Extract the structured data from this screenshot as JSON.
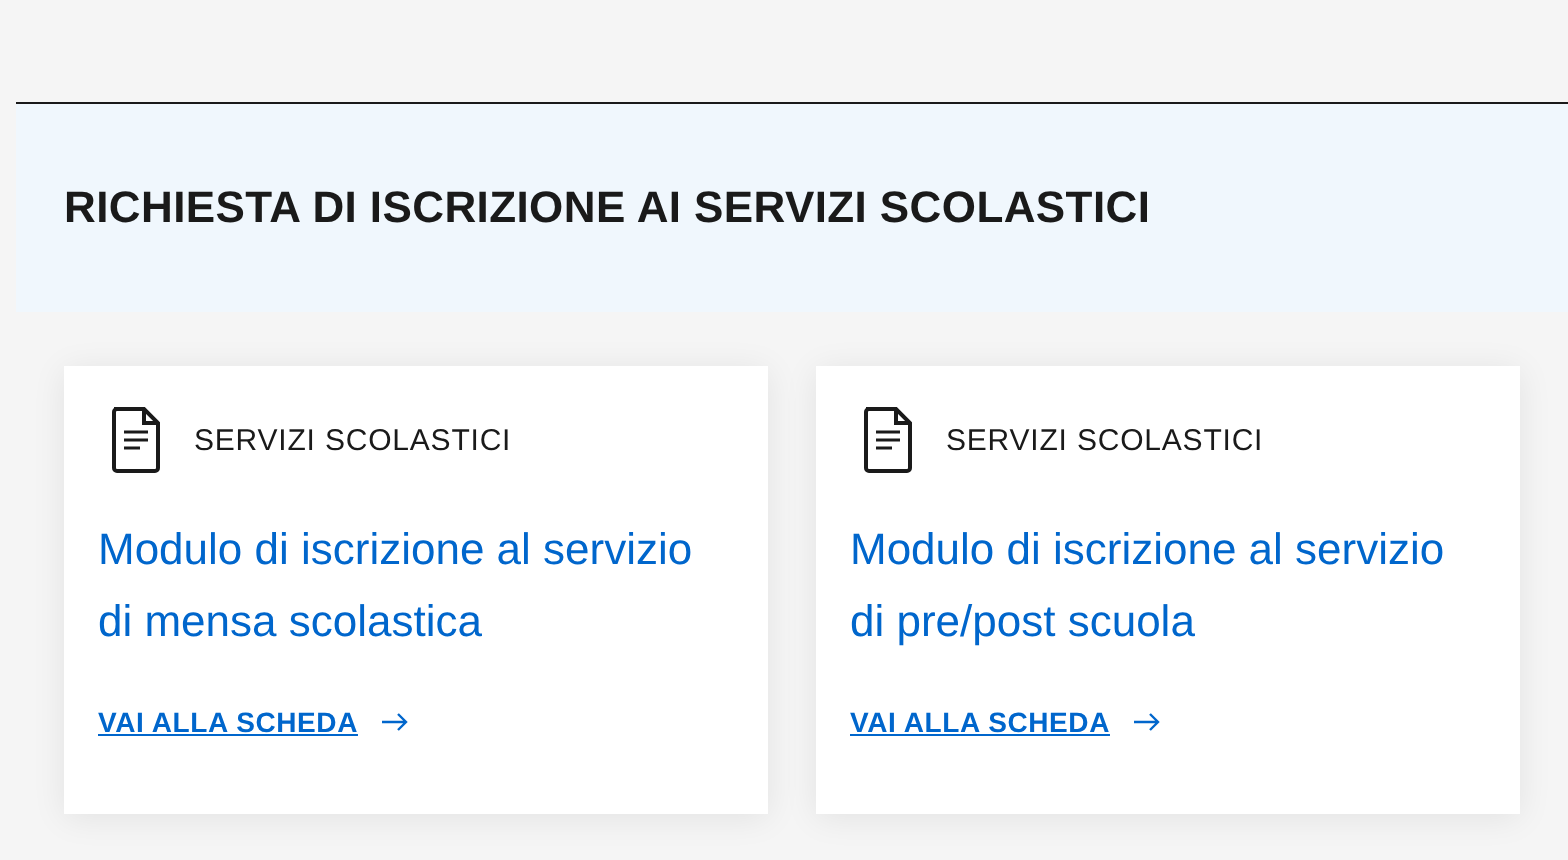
{
  "section": {
    "title": "RICHIESTA DI ISCRIZIONE AI SERVIZI SCOLASTICI"
  },
  "cards": [
    {
      "category": "SERVIZI SCOLASTICI",
      "title": "Modulo di iscrizione al servizio di mensa scolastica",
      "link": "VAI ALLA SCHEDA"
    },
    {
      "category": "SERVIZI SCOLASTICI",
      "title": "Modulo di iscrizione al servizio di pre/post scuola",
      "link": "VAI ALLA SCHEDA"
    }
  ]
}
